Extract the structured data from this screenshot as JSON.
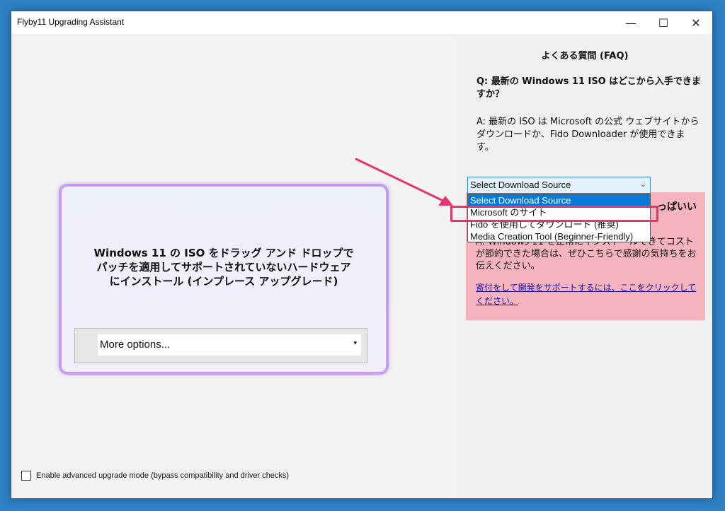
{
  "window": {
    "title": "Flyby11 Upgrading Assistant",
    "minimize": "—",
    "maximize": "☐",
    "close": "✕"
  },
  "left": {
    "drop_line1": "Windows 11 の ISO をドラッグ アンド ドロップで",
    "drop_line2": "パッチを適用してサポートされていないハードウェア",
    "drop_line3": "にインストール (インプレース アップグレード)",
    "more_options": "More options...",
    "more_arrow": "▾",
    "advanced_mode": "Enable advanced upgrade mode (bypass compatibility and driver checks)"
  },
  "right": {
    "faq_title": "よくある質問 (FAQ)",
    "question": "Q: 最新の Windows 11 ISO はどこから入手できますか？",
    "answer": "A: 最新の ISO は Microsoft の公式 ウェブサイトからダウンロードか、Fido Downloader が使用できます。",
    "download_source": {
      "selected": "Select Download Source",
      "arrow": "⌄",
      "options": [
        "Select Download Source",
        "Microsoft のサイト",
        "Fido を使用してダウンロード (推奨)",
        "Media Creation Tool (Beginner-Friendly)"
      ]
    },
    "donate_heading": "っぱいい",
    "donate_text": "A: Windows 11 を正常にインストールできてコストが節約できた場合は、ぜひこちらで感謝の気持ちをお伝えください。",
    "donate_link": "寄付をして開発をサポートするには、ここをクリックしてください。"
  },
  "colors": {
    "highlight": "#e8346d",
    "selection": "#0a78d7",
    "donate_bg": "#f5b3bd",
    "drop_border": "#c69cf2"
  }
}
